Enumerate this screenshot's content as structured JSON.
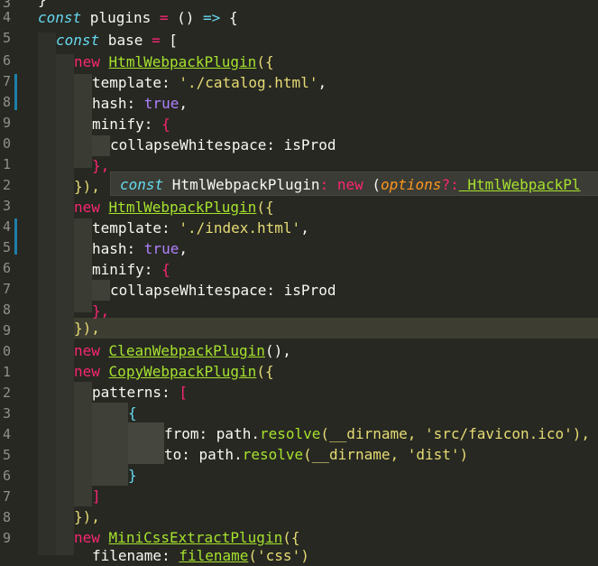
{
  "gutter": {
    "line_numbers": [
      "3",
      "4",
      "5",
      "6",
      "7",
      "8",
      "9",
      "0",
      "1",
      "2",
      "3",
      "4",
      "5",
      "6",
      "7",
      "8",
      "9",
      "0",
      "1",
      "2",
      "3",
      "4",
      "5",
      "6",
      "7",
      "8",
      "9"
    ]
  },
  "code": {
    "l0": "}",
    "l1_a": "const",
    "l1_b": " plugins ",
    "l1_c": "=",
    "l1_d": " () ",
    "l1_e": "=>",
    "l1_f": " {",
    "l2_a": "const",
    "l2_b": " base ",
    "l2_c": "=",
    "l2_d": " [",
    "l3_a": "new",
    "l3_b": "HtmlWebpackPlugin",
    "l3_c": "({",
    "l4_a": "template: ",
    "l4_b": "'./catalog.html'",
    "l4_c": ",",
    "l5_a": "hash: ",
    "l5_b": "true",
    "l5_c": ",",
    "l6_a": "minify: ",
    "l6_b": "{",
    "l7_a": "collapseWhitespace: isProd",
    "l8_a": "},",
    "l9_a": "}),",
    "l10_a": "new",
    "l10_b": "HtmlWebpackPlugin",
    "l10_c": "({",
    "l11_a": "template: ",
    "l11_b": "'./index.html'",
    "l11_c": ",",
    "l12_a": "hash: ",
    "l12_b": "true",
    "l12_c": ",",
    "l13_a": "minify: ",
    "l13_b": "{",
    "l14_a": "collapseWhitespace: isProd",
    "l15_a": "},",
    "l16_a": "}),",
    "l17_a": "new",
    "l17_b": "CleanWebpackPlugin",
    "l17_c": "(),",
    "l18_a": "new",
    "l18_b": "CopyWebpackPlugin",
    "l18_c": "({",
    "l19_a": "patterns: ",
    "l19_b": "[",
    "l20_a": "{",
    "l21_a": "from: path.",
    "l21_b": "resolve",
    "l21_c": "(__dirname, ",
    "l21_d": "'src/favicon.ico'",
    "l21_e": "),",
    "l22_a": "to: path.",
    "l22_b": "resolve",
    "l22_c": "(__dirname, ",
    "l22_d": "'dist'",
    "l22_e": ")",
    "l23_a": "}",
    "l24_a": "]",
    "l25_a": "}),",
    "l26_a": "new",
    "l26_b": "MiniCssExtractPlugin",
    "l26_c": "({",
    "l27_a": "filename: ",
    "l27_b": "filename",
    "l27_c": "(",
    "l27_d": "'css'",
    "l27_e": ")"
  },
  "tooltip": {
    "kw": "const",
    "name": " HtmlWebpackPlugin",
    "colon": ":",
    "new": " new",
    "open": " (",
    "param": "options",
    "q": "?:",
    "type": " HtmlWebpackPl"
  },
  "colors": {
    "background": "#272822",
    "keyword": "#f92672",
    "storage": "#66d9ef",
    "function": "#a6e22e",
    "string": "#e6db74",
    "constant": "#ae81ff",
    "modified_marker": "#1e7fa8"
  }
}
